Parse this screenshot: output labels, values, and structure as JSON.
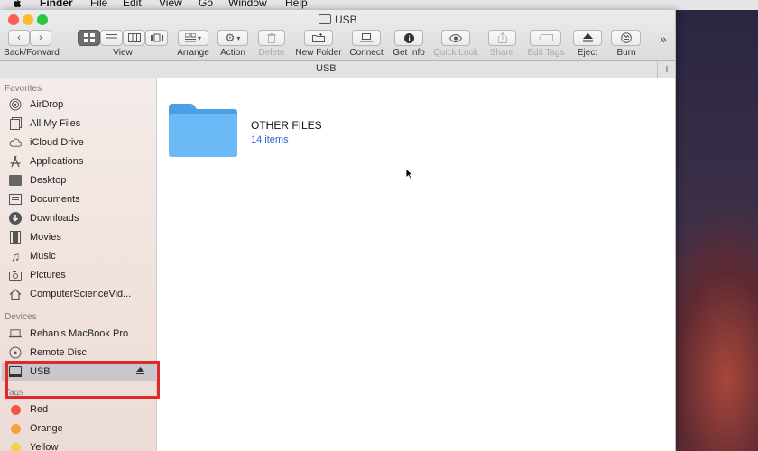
{
  "menubar": {
    "app": "Finder",
    "items": [
      "File",
      "Edit",
      "View",
      "Go",
      "Window",
      "Help"
    ]
  },
  "window": {
    "title": "USB"
  },
  "toolbar": {
    "back_forward_label": "Back/Forward",
    "view_label": "View",
    "arrange_label": "Arrange",
    "action_label": "Action",
    "delete_label": "Delete",
    "new_folder_label": "New Folder",
    "connect_label": "Connect",
    "get_info_label": "Get Info",
    "quick_look_label": "Quick Look",
    "share_label": "Share",
    "edit_tags_label": "Edit Tags",
    "eject_label": "Eject",
    "burn_label": "Burn",
    "more": "»"
  },
  "pathbar": {
    "title": "USB",
    "add": "+"
  },
  "sidebar": {
    "favorites_header": "Favorites",
    "favorites": [
      {
        "label": "AirDrop",
        "icon": "airdrop-icon"
      },
      {
        "label": "All My Files",
        "icon": "all-files-icon"
      },
      {
        "label": "iCloud Drive",
        "icon": "cloud-icon"
      },
      {
        "label": "Applications",
        "icon": "applications-icon"
      },
      {
        "label": "Desktop",
        "icon": "desktop-icon"
      },
      {
        "label": "Documents",
        "icon": "documents-icon"
      },
      {
        "label": "Downloads",
        "icon": "downloads-icon"
      },
      {
        "label": "Movies",
        "icon": "movies-icon"
      },
      {
        "label": "Music",
        "icon": "music-icon"
      },
      {
        "label": "Pictures",
        "icon": "pictures-icon"
      },
      {
        "label": "ComputerScienceVid...",
        "icon": "home-icon"
      }
    ],
    "devices_header": "Devices",
    "devices": [
      {
        "label": "Rehan's MacBook Pro",
        "icon": "laptop-icon"
      },
      {
        "label": "Remote Disc",
        "icon": "disc-icon"
      },
      {
        "label": "USB",
        "icon": "drive-icon",
        "selected": true
      }
    ],
    "tags_header": "Tags",
    "tags": [
      {
        "label": "Red",
        "color": "#f0544c"
      },
      {
        "label": "Orange",
        "color": "#f5a23b"
      },
      {
        "label": "Yellow",
        "color": "#f5d23b"
      }
    ]
  },
  "content": {
    "folder_name": "OTHER FILES",
    "folder_count": "14 items",
    "folder_color": "#5aaef0"
  },
  "colors": {
    "highlight_box": "#e02a2a",
    "close": "#fc5f57",
    "minimize": "#fdbc2e",
    "zoom": "#28c840"
  }
}
